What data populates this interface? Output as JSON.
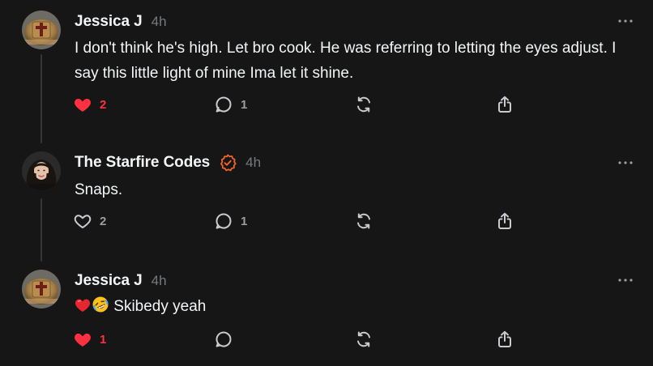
{
  "colors": {
    "background": "#161616",
    "text": "#f3f5f7",
    "muted": "#777b80",
    "liked": "#ff3040",
    "verified": "#f0642a"
  },
  "posts": [
    {
      "username": "Jessica J",
      "time": "4h",
      "verified": false,
      "text": "I don't think he's high. Let bro cook. He was referring to letting the eyes adjust. I say this little light of mine Ima let it shine.",
      "likes": "2",
      "liked": true,
      "replies": "1",
      "avatar": "cross-ring-avatar"
    },
    {
      "username": "The Starfire Codes",
      "time": "4h",
      "verified": true,
      "text": "Snaps.",
      "likes": "2",
      "liked": false,
      "replies": "1",
      "avatar": "portrait-avatar"
    },
    {
      "username": "Jessica J",
      "time": "4h",
      "verified": false,
      "text": "Skibedy yeah",
      "emoji_prefix": [
        "red-heart-emoji",
        "rolling-laughing-emoji"
      ],
      "likes": "1",
      "liked": true,
      "replies": "",
      "avatar": "cross-ring-avatar"
    }
  ]
}
